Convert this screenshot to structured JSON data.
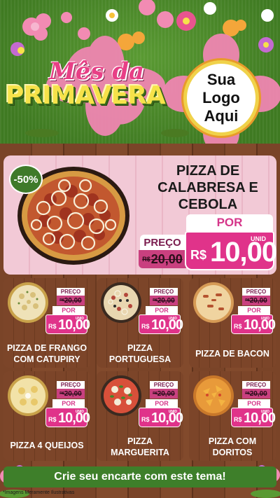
{
  "header": {
    "title_line1": "Mês da",
    "title_line2": "PRIMAVERA",
    "logo_text_line1": "Sua Logo",
    "logo_text_line2": "Aqui"
  },
  "featured": {
    "discount": "-50%",
    "name_line1": "PIZZA DE",
    "name_line2": "CALABRESA E",
    "name_line3": "CEBOLA",
    "preco_label": "PREÇO",
    "old_currency": "R$",
    "old_price": "20,00",
    "por_label": "POR",
    "new_currency": "R$",
    "new_price": "10,00",
    "unit": "UNID"
  },
  "products": [
    {
      "name_line1": "PIZZA DE FRANGO",
      "name_line2": "COM CATUPIRY",
      "preco_label": "PREÇO",
      "old_currency": "R$",
      "old_price": "20,00",
      "por_label": "POR",
      "new_currency": "R$",
      "new_price": "10,00",
      "unit": "UNID"
    },
    {
      "name_line1": "PIZZA",
      "name_line2": "PORTUGUESA",
      "preco_label": "PREÇO",
      "old_currency": "R$",
      "old_price": "20,00",
      "por_label": "POR",
      "new_currency": "R$",
      "new_price": "10,00",
      "unit": "UNID"
    },
    {
      "name_line1": "PIZZA DE BACON",
      "name_line2": "",
      "preco_label": "PREÇO",
      "old_currency": "R$",
      "old_price": "20,00",
      "por_label": "POR",
      "new_currency": "R$",
      "new_price": "10,00",
      "unit": "UNID"
    },
    {
      "name_line1": "PIZZA 4 QUEIJOS",
      "name_line2": "",
      "preco_label": "PREÇO",
      "old_currency": "R$",
      "old_price": "20,00",
      "por_label": "POR",
      "new_currency": "R$",
      "new_price": "10,00",
      "unit": "UNID"
    },
    {
      "name_line1": "PIZZA",
      "name_line2": "MARGUERITA",
      "preco_label": "PREÇO",
      "old_currency": "R$",
      "old_price": "20,00",
      "por_label": "POR",
      "new_currency": "R$",
      "new_price": "10,00",
      "unit": "UNID"
    },
    {
      "name_line1": "PIZZA COM",
      "name_line2": "DORITOS",
      "preco_label": "PREÇO",
      "old_currency": "R$",
      "old_price": "20,00",
      "por_label": "POR",
      "new_currency": "R$",
      "new_price": "10,00",
      "unit": "UNID"
    }
  ],
  "footer": {
    "cta": "Crie seu encarte com este tema!",
    "disclaimer": "*Imagens Meramente Ilustrativas"
  },
  "colors": {
    "accent_pink": "#e0338a",
    "green": "#3e7f2a",
    "title_yellow": "#f6e24a"
  }
}
